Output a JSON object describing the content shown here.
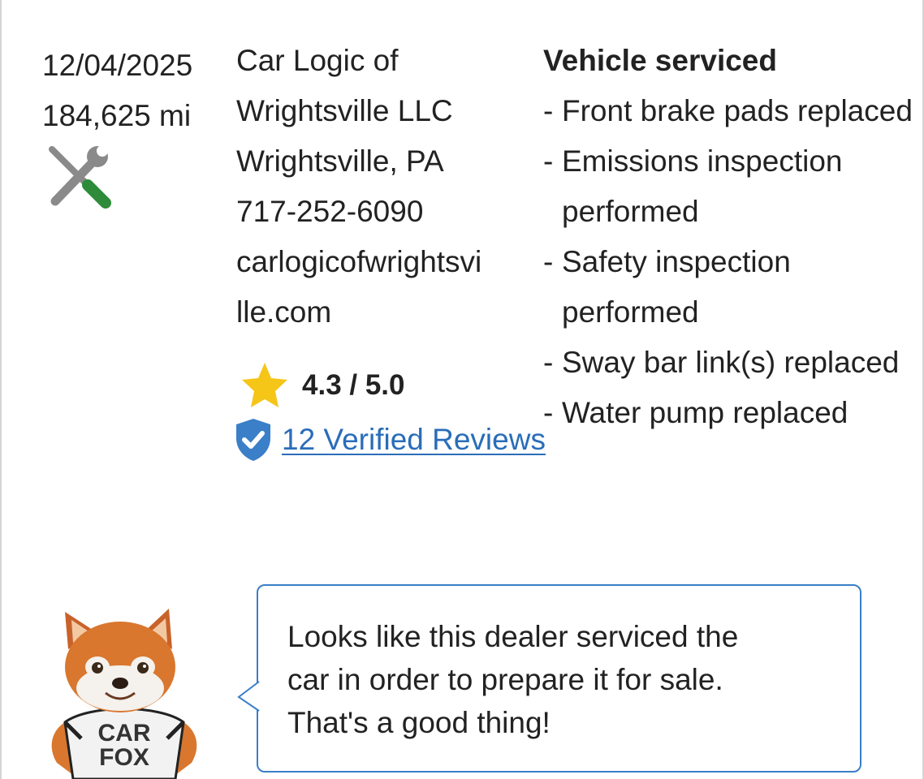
{
  "record": {
    "date": "12/04/2025",
    "mileage": "184,625 mi",
    "record_type_icon": "service-tools-icon",
    "dealer": {
      "name_line1": "Car Logic of",
      "name_line2": "Wrightsville LLC",
      "location": "Wrightsville, PA",
      "phone": "717-252-6090",
      "website_line1": "carlogicofwrightsvi",
      "website_line2": "lle.com",
      "rating": "4.3 / 5.0",
      "reviews_link": "12 Verified Reviews"
    },
    "service": {
      "heading": "Vehicle serviced",
      "items": [
        "Front brake pads replaced",
        "Emissions inspection performed",
        "Safety inspection performed",
        "Sway bar link(s) replaced",
        "Water pump replaced"
      ]
    }
  },
  "carfox": {
    "shirt_line1": "CAR",
    "shirt_line2": "FOX",
    "message_line1": "Looks like this dealer serviced the",
    "message_line2": "car in order to prepare it for sale.",
    "message_line3": "That's a good thing!"
  },
  "colors": {
    "link_blue": "#2a6db8",
    "star_gold": "#f5c518",
    "shield_blue": "#3a7fc8",
    "tool_gray": "#8a8a8a",
    "tool_green": "#2e8b3a",
    "bubble_border": "#3a7fc8"
  }
}
